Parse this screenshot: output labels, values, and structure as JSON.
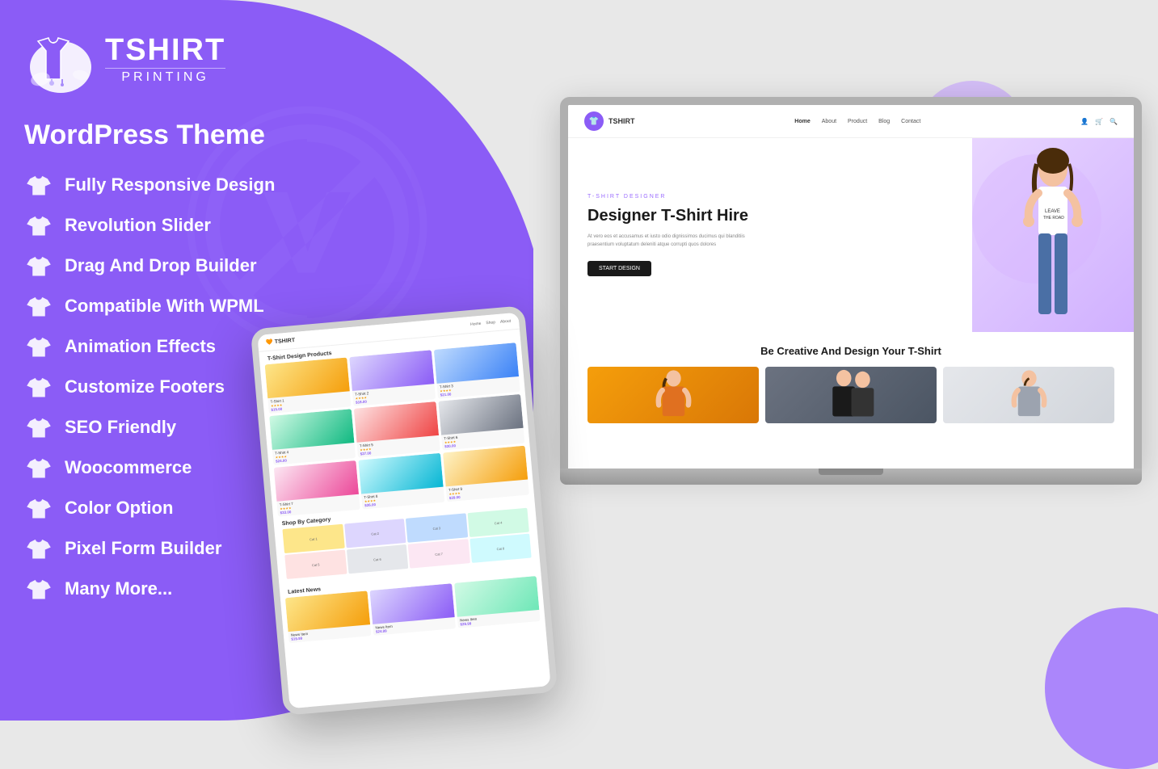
{
  "brand": {
    "name_line1": "TSHIRT",
    "name_line2": "PRINTING",
    "tagline": "WordPress Theme"
  },
  "features": [
    {
      "id": "responsive",
      "label": "Fully Responsive Design"
    },
    {
      "id": "revolution",
      "label": "Revolution Slider"
    },
    {
      "id": "drag-drop",
      "label": "Drag And Drop Builder"
    },
    {
      "id": "wpml",
      "label": "Compatible With WPML"
    },
    {
      "id": "animation",
      "label": "Animation Effects"
    },
    {
      "id": "footers",
      "label": "Customize Footers"
    },
    {
      "id": "seo",
      "label": "SEO Friendly"
    },
    {
      "id": "woo",
      "label": "Woocommerce"
    },
    {
      "id": "color",
      "label": "Color Option"
    },
    {
      "id": "pixel",
      "label": "Pixel Form Builder"
    },
    {
      "id": "more",
      "label": "Many More..."
    }
  ],
  "laptop": {
    "nav": {
      "logo": "TSHIRT",
      "links": [
        "Home",
        "About",
        "Product",
        "Blog",
        "Contact"
      ],
      "active_link": "Home"
    },
    "hero": {
      "subtitle": "T-SHIRT DESIGNER",
      "title": "Designer T-Shirt Hire",
      "description": "At vero eos et accusamus et iusto odio dignissimos ducimus qui blanditiis praesentium voluptatum deleniti atque corrupti quos dolores",
      "cta_button": "START DESIGN"
    },
    "second_section": {
      "title": "Be Creative And Design Your T-Shirt"
    }
  },
  "tablet": {
    "section_title": "T-Shirt Design Products",
    "category_title": "Shop By Category",
    "news_title": "Latest News"
  },
  "colors": {
    "purple": "#8b5cf6",
    "purple_dark": "#7c3aed",
    "purple_light": "#c4b5fd",
    "bg_gray": "#e8e8e8"
  }
}
